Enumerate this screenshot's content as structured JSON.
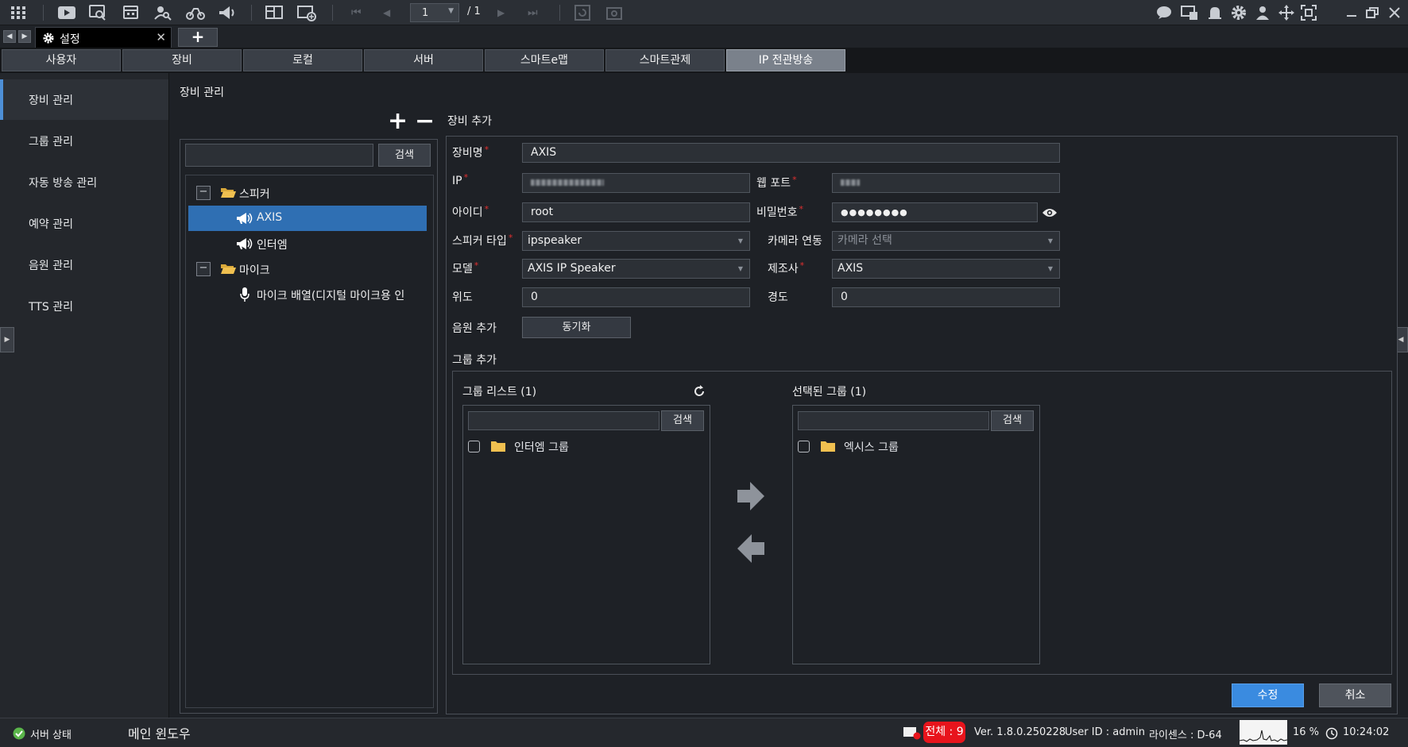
{
  "toolbar": {
    "page_current": "1",
    "page_total": "/ 1",
    "left_icons": [
      "grid-icon",
      "play-icon",
      "search-video-icon",
      "calendar-icon",
      "person-search-icon",
      "event-icon",
      "broadcast-icon",
      "layout-icon",
      "add-layout-icon"
    ],
    "right_icons": [
      "chat-icon",
      "monitor-settings-icon",
      "alarm-icon",
      "gear-icon",
      "user-icon",
      "move-icon",
      "fullscreen-icon",
      "minimize-icon",
      "restore-icon",
      "close-icon"
    ]
  },
  "window_tab": {
    "label": "설정"
  },
  "category_tabs": [
    "사용자",
    "장비",
    "로컬",
    "서버",
    "스마트e맵",
    "스마트관제",
    "IP 전관방송"
  ],
  "sidebar": {
    "items": [
      {
        "label": "장비 관리"
      },
      {
        "label": "그룹 관리"
      },
      {
        "label": "자동 방송 관리"
      },
      {
        "label": "예약 관리"
      },
      {
        "label": "음원 관리"
      },
      {
        "label": "TTS 관리"
      }
    ]
  },
  "main": {
    "title": "장비 관리",
    "tree": {
      "search_button": "검색",
      "search_value": "",
      "nodes": [
        {
          "label": "스피커",
          "toggle": "−"
        },
        {
          "label": "AXIS"
        },
        {
          "label": "인터엠"
        },
        {
          "label": "마이크",
          "toggle": "−"
        },
        {
          "label": "마이크 배열(디지털 마이크용 인"
        }
      ]
    },
    "form": {
      "title": "장비 추가",
      "device_name_label": "장비명",
      "device_name": "AXIS",
      "ip_label": "IP",
      "web_port_label": "웹 포트",
      "id_label": "아이디",
      "id_value": "root",
      "password_label": "비밀번호",
      "password_value": "●●●●●●●●",
      "speaker_type_label": "스피커 타입",
      "speaker_type": "ipspeaker",
      "camera_link_label": "카메라 연동",
      "camera_link": "카메라 선택",
      "model_label": "모델",
      "model": "AXIS IP Speaker",
      "maker_label": "제조사",
      "maker": "AXIS",
      "lat_label": "위도",
      "lat": "0",
      "lng_label": "경도",
      "lng": "0",
      "sound_add_label": "음원 추가",
      "sync_button": "동기화",
      "group_add_label": "그룹 추가",
      "group_list_title": "그룹 리스트 (1)",
      "selected_group_title": "선택된 그룹 (1)",
      "search_button": "검색",
      "group_list_items": [
        "인터엠 그룹"
      ],
      "selected_group_items": [
        "엑시스 그룹"
      ],
      "save_button": "수정",
      "cancel_button": "취소"
    }
  },
  "statusbar": {
    "server_status": "서버 상태",
    "main_window": "메인 윈도우",
    "total": "전체 : 9",
    "version": "Ver. 1.8.0.250228",
    "user": "User ID : admin",
    "license": "라이센스 : D-64",
    "cpu": "16 %",
    "time": "10:24:02"
  },
  "colors": {
    "accent": "#3a8be0",
    "selected_row": "#2f6fb3",
    "alert": "#e8141c",
    "required": "#e03030"
  }
}
